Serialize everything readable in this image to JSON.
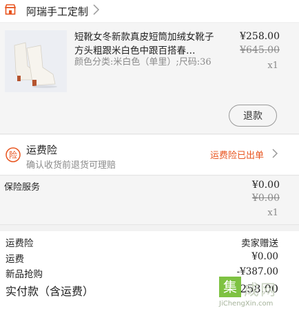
{
  "shop": {
    "name": "阿瑞手工定制"
  },
  "product": {
    "title": "短靴女冬新款真皮短筒加绒女靴子方头粗跟米白色中跟百搭春…",
    "sku": "颜色分类:米白色（单里）;尺码:36",
    "price": "¥258.00",
    "original_price": "¥645.00",
    "quantity": "x1",
    "refund_label": "退款"
  },
  "freight_insurance": {
    "title": "运费险",
    "subtitle": "确认收货前退货可理赔",
    "status": "运费险已出单",
    "badge": "险"
  },
  "insurance_service": {
    "label": "保险服务",
    "price": "¥0.00",
    "original_price": "¥0.00",
    "quantity": "x1"
  },
  "summary": {
    "rows": [
      {
        "label": "运费险",
        "value": "卖家赠送"
      },
      {
        "label": "运费",
        "value": "¥0.00"
      },
      {
        "label": "新品抢购",
        "value": "-¥387.00"
      }
    ],
    "total_label": "实付款（含运费）",
    "total_value": "¥258.00"
  },
  "watermark": {
    "logo_char": "集",
    "chars": "成网",
    "url": "JiChengXin.com"
  },
  "colors": {
    "accent": "#e8541e",
    "watermark_green": "#7ec242"
  },
  "icons": {
    "shop": "shop-icon",
    "chevron": "chevron-right-icon",
    "insurance": "shield-icon"
  }
}
